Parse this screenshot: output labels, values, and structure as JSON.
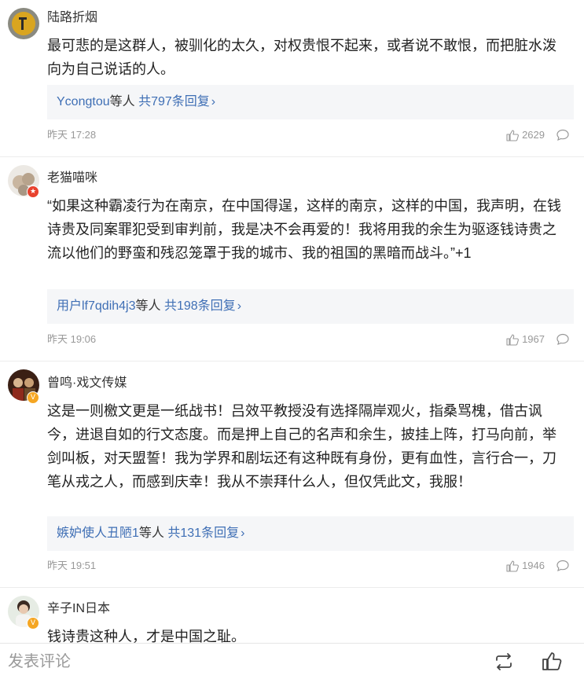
{
  "comments": [
    {
      "username": "陆路折烟",
      "text": "最可悲的是这群人，被驯化的太久，对权贵恨不起来，或者说不敢恨，而把脏水泼向为自己说话的人。",
      "replies": {
        "who": "Ycongtou",
        "mid": "等人",
        "count": "共797条回复"
      },
      "time": "昨天 17:28",
      "likes": "2629"
    },
    {
      "username": "老猫喵咪",
      "badge": "red",
      "text": "“如果这种霸凌行为在南京，在中国得逞，这样的南京，这样的中国，我声明，在钱诗贵及同案罪犯受到审判前，我是决不会再爱的！我将用我的余生为驱逐钱诗贵之流以他们的野蛮和残忍笼罩于我的城市、我的祖国的黑暗而战斗。”+1",
      "replies": {
        "who": "用户lf7qdih4j3",
        "mid": "等人",
        "count": "共198条回复"
      },
      "time": "昨天 19:06",
      "likes": "1967"
    },
    {
      "username": "曾鸣·戏文传媒",
      "badge": "gold",
      "text": "这是一则檄文更是一纸战书！吕效平教授没有选择隔岸观火，指桑骂槐，借古讽今，进退自如的行文态度。而是押上自己的名声和余生，披挂上阵，打马向前，举剑叫板，对天盟誓！我为学界和剧坛还有这种既有身份，更有血性，言行合一，刀笔从戎之人，而感到庆幸！我从不崇拜什么人，但仅凭此文，我服！",
      "replies": {
        "who": "嫉妒使人丑陋1",
        "mid": "等人",
        "count": "共131条回复"
      },
      "time": "昨天 19:51",
      "likes": "1946"
    },
    {
      "username": "辛子IN日本",
      "badge": "gold",
      "text": "钱诗贵这种人，才是中国之耻。"
    }
  ],
  "bottom_bar": {
    "placeholder": "发表评论"
  },
  "colors": {
    "link": "#3f6fb5",
    "reply_bg": "#f5f6f8",
    "muted": "#999999"
  }
}
